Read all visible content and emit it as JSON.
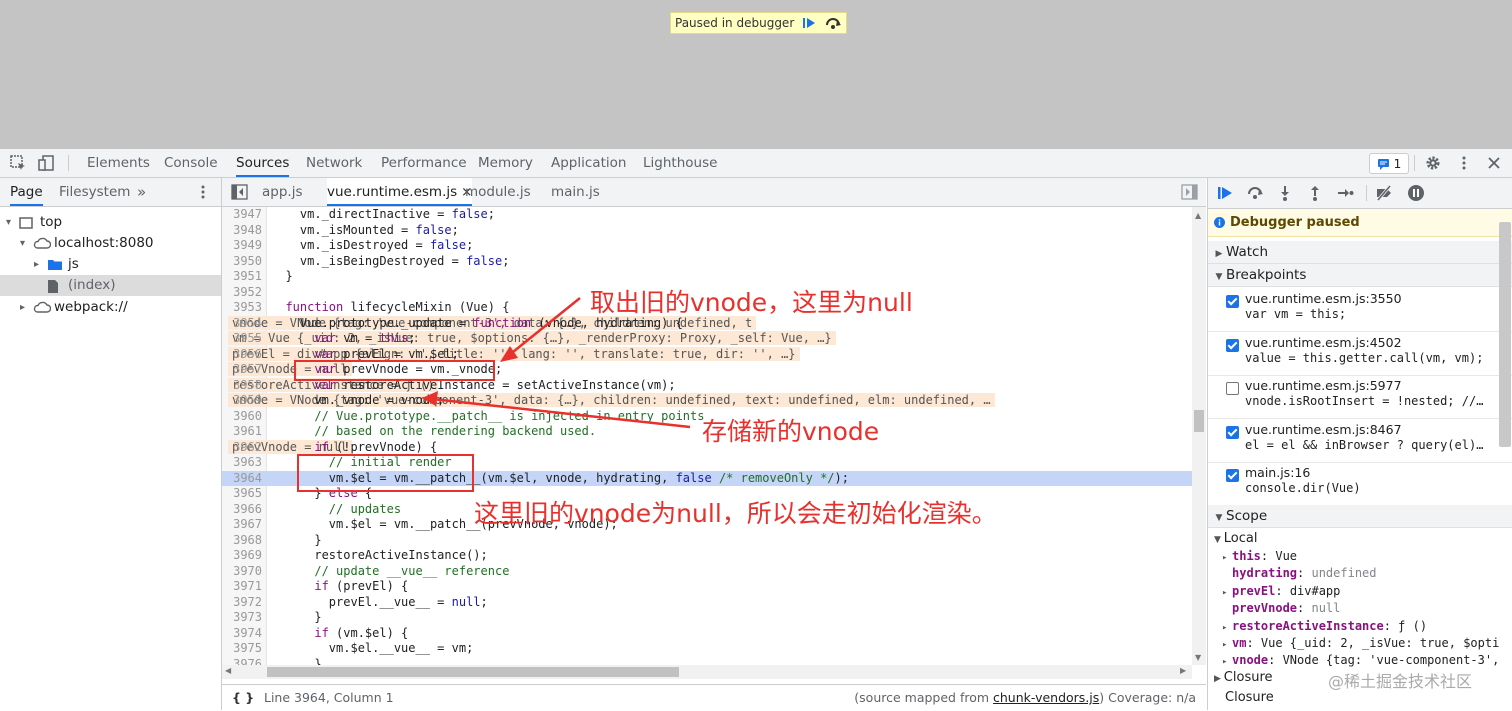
{
  "viewport": {
    "paused_text": "Paused in debugger"
  },
  "devtools": {
    "tabs": [
      "Elements",
      "Console",
      "Sources",
      "Network",
      "Performance",
      "Memory",
      "Application",
      "Lighthouse"
    ],
    "active_tab": "Sources",
    "issues_count": "1"
  },
  "navigator": {
    "tabs": [
      "Page",
      "Filesystem"
    ],
    "more": "»",
    "tree": [
      {
        "label": "top",
        "icon": "frame-icon",
        "indent": 0,
        "arrow": "▾"
      },
      {
        "label": "localhost:8080",
        "icon": "cloud-icon",
        "indent": 1,
        "arrow": "▾"
      },
      {
        "label": "js",
        "icon": "folder-icon",
        "indent": 2,
        "arrow": "▸"
      },
      {
        "label": "(index)",
        "icon": "file-icon",
        "indent": 2,
        "arrow": ""
      },
      {
        "label": "webpack://",
        "icon": "cloud-icon",
        "indent": 1,
        "arrow": "▸"
      }
    ]
  },
  "editor": {
    "tabs": [
      "app.js",
      "vue.runtime.esm.js",
      "module.js",
      "main.js"
    ],
    "active_tab": "vue.runtime.esm.js",
    "close_glyph": "×",
    "lines": [
      {
        "n": "3947",
        "code": "    vm._directInactive = false;"
      },
      {
        "n": "3948",
        "code": "    vm._isMounted = false;"
      },
      {
        "n": "3949",
        "code": "    vm._isDestroyed = false;"
      },
      {
        "n": "3950",
        "code": "    vm._isBeingDestroyed = false;"
      },
      {
        "n": "3951",
        "code": "  }"
      },
      {
        "n": "3952",
        "code": ""
      },
      {
        "n": "3953",
        "code": "  function lifecycleMixin (Vue) {"
      },
      {
        "n": "3954",
        "code": "    Vue.prototype._update = function (vnode, hydrating) {",
        "hint": "vnode = VNode {tag: 'vue-component-3', data: {…}, children: undefined, t"
      },
      {
        "n": "3955",
        "code": "      var vm = this;",
        "hint": "vm = Vue {_uid: 2, _isVue: true, $options: {…}, _renderProxy: Proxy, _self: Vue, …}"
      },
      {
        "n": "3956",
        "code": "      var prevEl = vm.$el;",
        "hint": "prevEl = div#app {align: '', title: '', lang: '', translate: true, dir: '', …}"
      },
      {
        "n": "3957",
        "code": "      var prevVnode = vm._vnode;",
        "hint": "prevVnode = null"
      },
      {
        "n": "3958",
        "code": "      var restoreActiveInstance = setActiveInstance(vm);",
        "hint": "restoreActiveInstance = ƒ ()"
      },
      {
        "n": "3959",
        "code": "      vm._vnode = vnode;",
        "hint": "vnode = VNode {tag: 'vue-component-3', data: {…}, children: undefined, text: undefined, elm: undefined, …"
      },
      {
        "n": "3960",
        "code": "      // Vue.prototype.__patch__ is injected in entry points"
      },
      {
        "n": "3961",
        "code": "      // based on the rendering backend used."
      },
      {
        "n": "3962",
        "code": "      if (!prevVnode) {",
        "hint": "prevVnode = null"
      },
      {
        "n": "3963",
        "code": "        // initial render"
      },
      {
        "n": "3964",
        "code": "        vm.$el = vm.__patch__(vm.$el, vnode, hydrating, false /* removeOnly */);"
      },
      {
        "n": "3965",
        "code": "      } else {"
      },
      {
        "n": "3966",
        "code": "        // updates"
      },
      {
        "n": "3967",
        "code": "        vm.$el = vm.__patch__(prevVnode, vnode);"
      },
      {
        "n": "3968",
        "code": "      }"
      },
      {
        "n": "3969",
        "code": "      restoreActiveInstance();"
      },
      {
        "n": "3970",
        "code": "      // update __vue__ reference"
      },
      {
        "n": "3971",
        "code": "      if (prevEl) {"
      },
      {
        "n": "3972",
        "code": "        prevEl.__vue__ = null;"
      },
      {
        "n": "3973",
        "code": "      }"
      },
      {
        "n": "3974",
        "code": "      if (vm.$el) {"
      },
      {
        "n": "3975",
        "code": "        vm.$el.__vue__ = vm;"
      },
      {
        "n": "3976",
        "code": "      }"
      }
    ],
    "status_left": "Line 3964, Column 1",
    "status_mapped_prefix": "(source mapped from ",
    "status_mapped_link": "chunk-vendors.js",
    "status_mapped_suffix": ") Coverage: n/a"
  },
  "sidebar": {
    "paused_title": "Debugger paused",
    "watch_label": "Watch",
    "breakpoints_label": "Breakpoints",
    "breakpoints": [
      {
        "loc": "vue.runtime.esm.js:3550",
        "code": "var vm = this;",
        "checked": true
      },
      {
        "loc": "vue.runtime.esm.js:4502",
        "code": "value = this.getter.call(vm, vm);",
        "checked": true
      },
      {
        "loc": "vue.runtime.esm.js:5977",
        "code": "vnode.isRootInsert = !nested; //…",
        "checked": false
      },
      {
        "loc": "vue.runtime.esm.js:8467",
        "code": "el = el && inBrowser ? query(el)…",
        "checked": true
      },
      {
        "loc": "main.js:16",
        "code": "console.dir(Vue)",
        "checked": true
      }
    ],
    "scope_label": "Scope",
    "local_label": "Local",
    "scope": [
      {
        "arrow": "▸",
        "key": "this",
        "val": "Vue"
      },
      {
        "arrow": "",
        "key": "hydrating",
        "val": "undefined"
      },
      {
        "arrow": "▸",
        "key": "prevEl",
        "val": "div#app"
      },
      {
        "arrow": "",
        "key": "prevVnode",
        "val": "null"
      },
      {
        "arrow": "▸",
        "key": "restoreActiveInstance",
        "val": "ƒ ()"
      },
      {
        "arrow": "▸",
        "key": "vm",
        "val": "Vue {_uid: 2, _isVue: true, $opti"
      },
      {
        "arrow": "▸",
        "key": "vnode",
        "val": "VNode {tag: 'vue-component-3',"
      }
    ],
    "closure_label": "Closure",
    "closure2_label": "Closure"
  },
  "annotations": {
    "a1": "取出旧的vnode，这里为null",
    "a2": "存储新的vnode",
    "a3": "这里旧的vnode为null，所以会走初始化渲染。"
  },
  "watermark": "@稀土掘金技术社区",
  "colors": {
    "accent": "#1a73e8",
    "annotation": "#e8302c",
    "hint_bg": "#fce8d4",
    "exec_bg": "#c4d5f7"
  }
}
